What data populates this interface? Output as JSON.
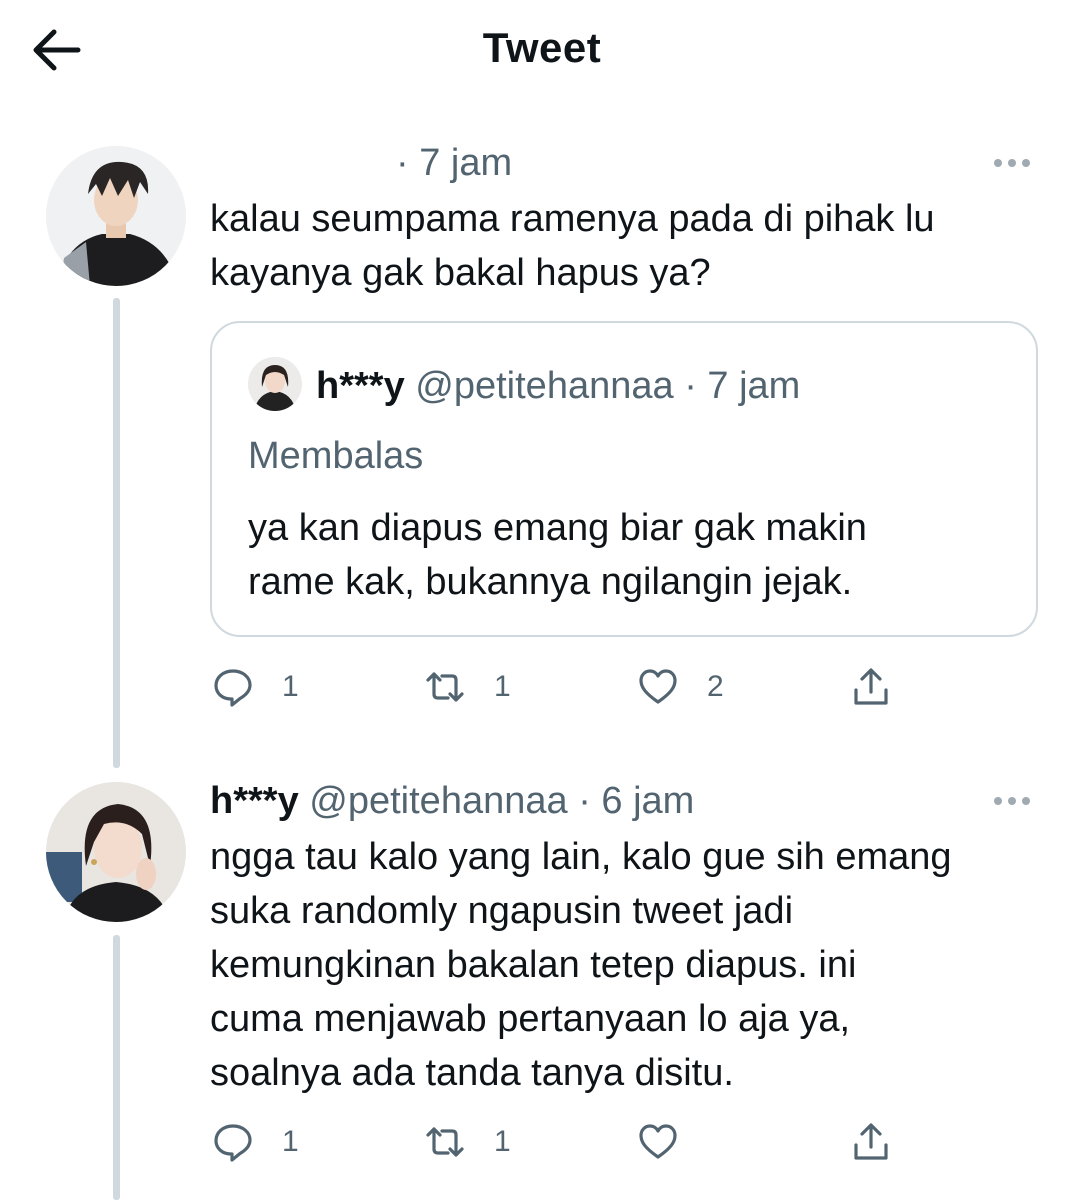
{
  "header": {
    "back_icon": "arrow-left-icon",
    "title": "Tweet"
  },
  "tweet1": {
    "meta": "· 7 jam",
    "text": "kalau seumpama ramenya pada di pihak lu\nkayanya gak bakal hapus ya?",
    "quote": {
      "name": "h***y",
      "handle": "@petitehannaa",
      "time": "· 7 jam",
      "replying": "Membalas",
      "text": "ya kan diapus emang biar gak makin\nrame kak, bukannya ngilangin jejak."
    },
    "actions": {
      "reply_count": "1",
      "retweet_count": "1",
      "like_count": "2"
    }
  },
  "tweet2": {
    "name": "h***y",
    "handle": "@petitehannaa",
    "time": "· 6 jam",
    "text": "ngga tau kalo yang lain, kalo gue sih emang\nsuka randomly ngapusin tweet jadi\nkemungkinan bakalan tetep diapus. ini\ncuma menjawab pertanyaan lo aja ya,\nsoalnya ada tanda tanya disitu.",
    "actions": {
      "reply_count": "1",
      "retweet_count": "1",
      "like_count": ""
    }
  },
  "colors": {
    "text_primary": "#0f1419",
    "text_secondary": "#536471",
    "border": "#cfd9de",
    "thread_line": "#cfd9de"
  }
}
